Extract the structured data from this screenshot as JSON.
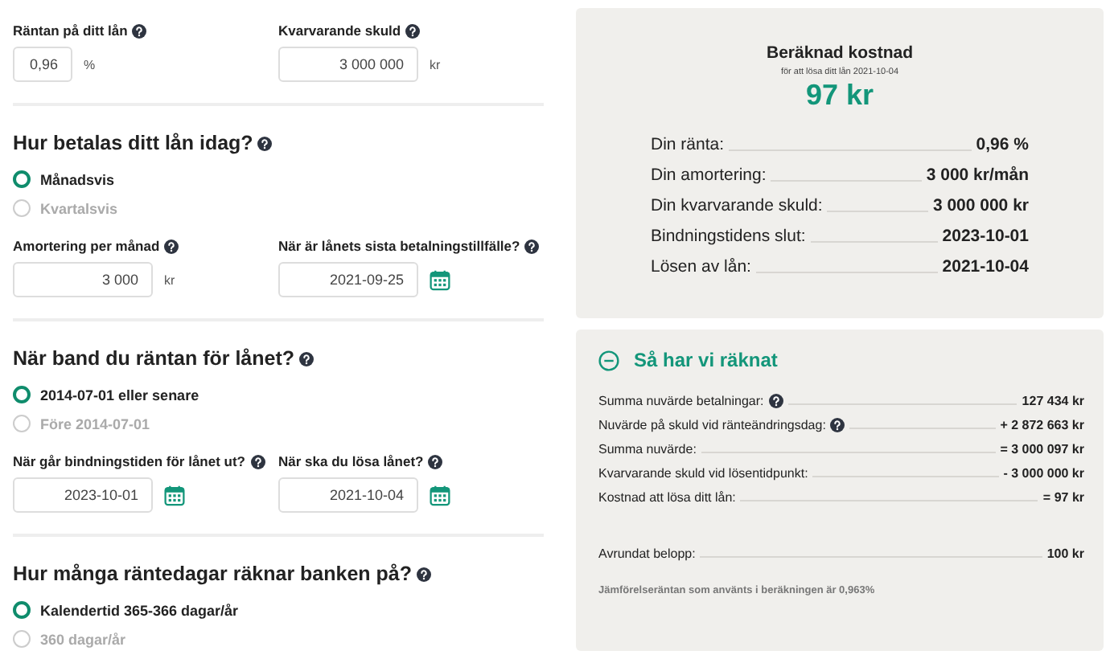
{
  "form": {
    "sections": [
      {
        "fields": [
          {
            "label": "Räntan på ditt lån",
            "value": "0,96",
            "unit": "%",
            "kind": "narrow"
          },
          {
            "label": "Kvarvarande skuld",
            "value": "3 000 000",
            "unit": "kr",
            "kind": "number"
          }
        ]
      },
      {
        "heading": "Hur betalas ditt lån idag?",
        "radios": [
          {
            "label": "Månadsvis",
            "selected": true
          },
          {
            "label": "Kvartalsvis",
            "selected": false
          }
        ],
        "fields": [
          {
            "label": "Amortering per månad",
            "value": "3 000",
            "unit": "kr",
            "kind": "number"
          },
          {
            "label": "När är lånets sista betalningstillfälle?",
            "value": "2021-09-25",
            "kind": "date"
          }
        ]
      },
      {
        "heading": "När band du räntan för lånet?",
        "radios": [
          {
            "label": "2014-07-01 eller senare",
            "selected": true
          },
          {
            "label": "Före 2014-07-01",
            "selected": false
          }
        ],
        "fields": [
          {
            "label": "När går bindningstiden för lånet ut?",
            "value": "2023-10-01",
            "kind": "date"
          },
          {
            "label": "När ska du lösa lånet?",
            "value": "2021-10-04",
            "kind": "date"
          }
        ]
      },
      {
        "heading": "Hur många räntedagar räknar banken på?",
        "radios": [
          {
            "label": "Kalendertid 365-366 dagar/år",
            "selected": true
          },
          {
            "label": "360 dagar/år",
            "selected": false
          }
        ]
      }
    ]
  },
  "result": {
    "title": "Beräknad kostnad",
    "subtitle": "för att lösa ditt lån 2021-10-04",
    "amount": "97 kr",
    "rows": [
      {
        "label": "Din ränta:",
        "value": "0,96 %"
      },
      {
        "label": "Din amortering:",
        "value": "3 000 kr/mån"
      },
      {
        "label": "Din kvarvarande skuld:",
        "value": "3 000 000 kr"
      },
      {
        "label": "Bindningstidens slut:",
        "value": "2023-10-01"
      },
      {
        "label": "Lösen av lån:",
        "value": "2021-10-04"
      }
    ]
  },
  "calculation": {
    "heading": "Så har vi räknat",
    "expanded": true,
    "rows": [
      {
        "label": "Summa nuvärde betalningar:",
        "value": "127 434 kr",
        "help": true
      },
      {
        "label": "Nuvärde på skuld vid ränteändringsdag:",
        "value": "+ 2 872 663 kr",
        "help": true
      },
      {
        "label": "Summa nuvärde:",
        "value": "= 3 000 097 kr",
        "help": false
      },
      {
        "label": "Kvarvarande skuld vid lösentidpunkt:",
        "value": "- 3 000 000 kr",
        "help": false
      },
      {
        "label": "Kostnad att lösa ditt lån:",
        "value": "= 97 kr",
        "help": false
      }
    ],
    "rounded": {
      "label": "Avrundat belopp:",
      "value": "100 kr"
    },
    "note": "Jämförelseräntan som använts i beräkningen är 0,963%"
  }
}
